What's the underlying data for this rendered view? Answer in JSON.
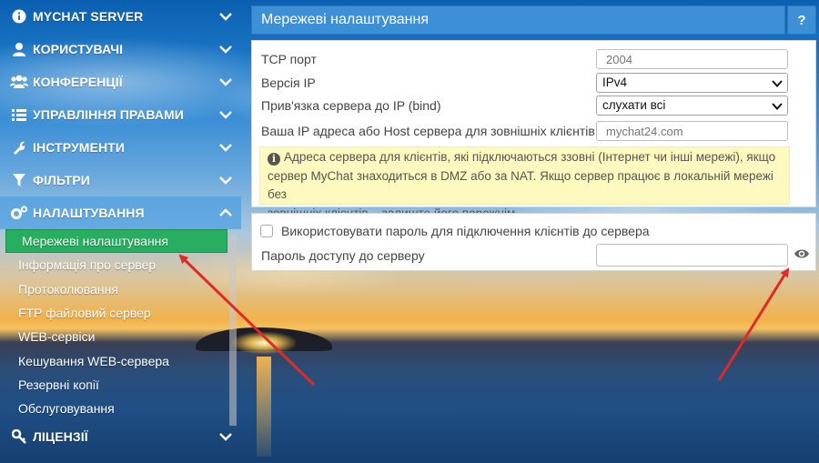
{
  "sidebar": {
    "items": [
      {
        "icon": "info-circle-icon",
        "label": "MYCHAT SERVER"
      },
      {
        "icon": "user-icon",
        "label": "КОРИСТУВАЧІ"
      },
      {
        "icon": "users-icon",
        "label": "КОНФЕРЕНЦІЇ"
      },
      {
        "icon": "list-icon",
        "label": "УПРАВЛІННЯ ПРАВАМИ"
      },
      {
        "icon": "wrench-icon",
        "label": "ІНСТРУМЕНТИ"
      },
      {
        "icon": "filter-icon",
        "label": "ФІЛЬТРИ"
      },
      {
        "icon": "gears-icon",
        "label": "НАЛАШТУВАННЯ"
      }
    ],
    "submenu": [
      "Мережеві налаштування",
      "Інформація про сервер",
      "Протоколювання",
      "FTP файловий сервер",
      "WEB-сервіси",
      "Кешування WEB-сервера",
      "Резервні копії",
      "Обслуговування"
    ],
    "last_item": {
      "icon": "key-icon",
      "label": "ЛІЦЕНЗІЇ"
    }
  },
  "header": {
    "title": "Мережеві налаштування",
    "help": "?"
  },
  "network": {
    "tcp_port_label": "TCP порт",
    "tcp_port_placeholder": "2004",
    "ip_version_label": "Версія IP",
    "ip_version_value": "IPv4",
    "bind_label": "Прив'язка сервера до IP (bind)",
    "bind_value": "слухати всі",
    "external_ip_label": "Ваша IP адреса або Host сервера для зовнішніх клієнтів",
    "external_ip_placeholder": "mychat24.com",
    "note_line1": "Адреса сервера для клієнтів, які підключаються ззовні (Інтернет чи інші мережі), якщо",
    "note_line2": "сервер MyChat знаходиться в DMZ або за NAT. Якщо сервер працює в локальній мережі без",
    "note_line3": "зовнішніх клієнтів – залиште його порожнім."
  },
  "password": {
    "use_password_label": "Використовувати пароль для підключення клієнтів до сервера",
    "use_password_checked": false,
    "password_label": "Пароль доступу до серверу",
    "password_value": ""
  },
  "colors": {
    "accent": "#3d8fd6",
    "selected": "#27ae60",
    "note_bg": "#fdf9bf",
    "arrow": "#e02a2a"
  }
}
